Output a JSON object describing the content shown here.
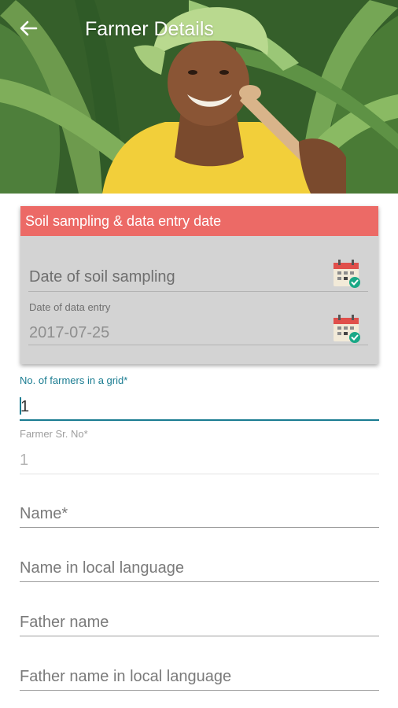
{
  "header": {
    "title": "Farmer Details",
    "back_icon": "arrow-left-icon"
  },
  "colors": {
    "accent": "#1a7c91",
    "card_header": "#ec6a66",
    "card_bg": "#d3d3d3"
  },
  "sampling_card": {
    "header": "Soil sampling & data entry date",
    "soil_sampling_placeholder": "Date of soil sampling",
    "data_entry_label": "Date of data entry",
    "data_entry_value": "2017-07-25",
    "calendar_icon": "calendar-check-icon"
  },
  "form": {
    "farmers_in_grid": {
      "label": "No. of farmers in a grid*",
      "value": "1"
    },
    "farmer_sr_no": {
      "label": "Farmer Sr. No*",
      "value": "1"
    },
    "name": {
      "placeholder": "Name*"
    },
    "name_local": {
      "placeholder": "Name in local language"
    },
    "father_name": {
      "placeholder": "Father name"
    },
    "father_name_local": {
      "placeholder": "Father name in local language"
    }
  }
}
